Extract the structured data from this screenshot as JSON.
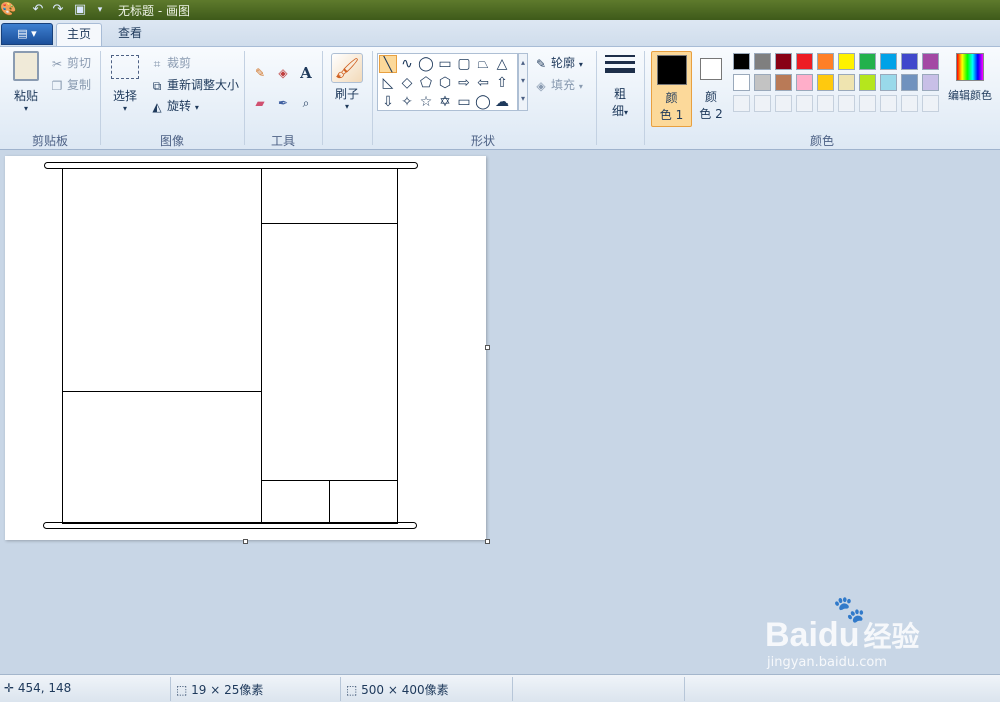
{
  "titlebar": {
    "title": "无标题 - 画图"
  },
  "tabs": [
    {
      "label": "主页"
    },
    {
      "label": "查看"
    }
  ],
  "clipboard": {
    "paste": "粘贴",
    "cut": "剪切",
    "copy": "复制",
    "group": "剪贴板"
  },
  "image": {
    "select": "选择",
    "crop": "裁剪",
    "resize": "重新调整大小",
    "rotate": "旋转",
    "group": "图像"
  },
  "tools": {
    "group": "工具"
  },
  "brush": {
    "label": "刷子"
  },
  "shapes": {
    "outline": "轮廓",
    "fill": "填充",
    "group": "形状"
  },
  "size": {
    "label_line1": "粗",
    "label_line2": "细"
  },
  "colors": {
    "color1_line1": "颜",
    "color1_line2": "色 1",
    "color2_line1": "颜",
    "color2_line2": "色 2",
    "edit": "编辑颜色",
    "group": "颜色",
    "color1": "#000000",
    "color2": "#ffffff",
    "row1": [
      "#000000",
      "#7f7f7f",
      "#880015",
      "#ed1c24",
      "#ff7f27",
      "#fff200",
      "#22b14c",
      "#00a2e8",
      "#3f48cc",
      "#a349a4"
    ],
    "row2": [
      "#ffffff",
      "#c3c3c3",
      "#b97a57",
      "#ffaec9",
      "#ffc90e",
      "#efe4b0",
      "#b5e61d",
      "#99d9ea",
      "#7092be",
      "#c8bfe7"
    ]
  },
  "status": {
    "cursor": "454, 148",
    "selection": "19 × 25像素",
    "canvas_size": "500 × 400像素"
  },
  "watermark": {
    "brand": "Bai",
    "brand2": "du",
    "brand3": "经验",
    "url": "jingyan.baidu.com"
  }
}
